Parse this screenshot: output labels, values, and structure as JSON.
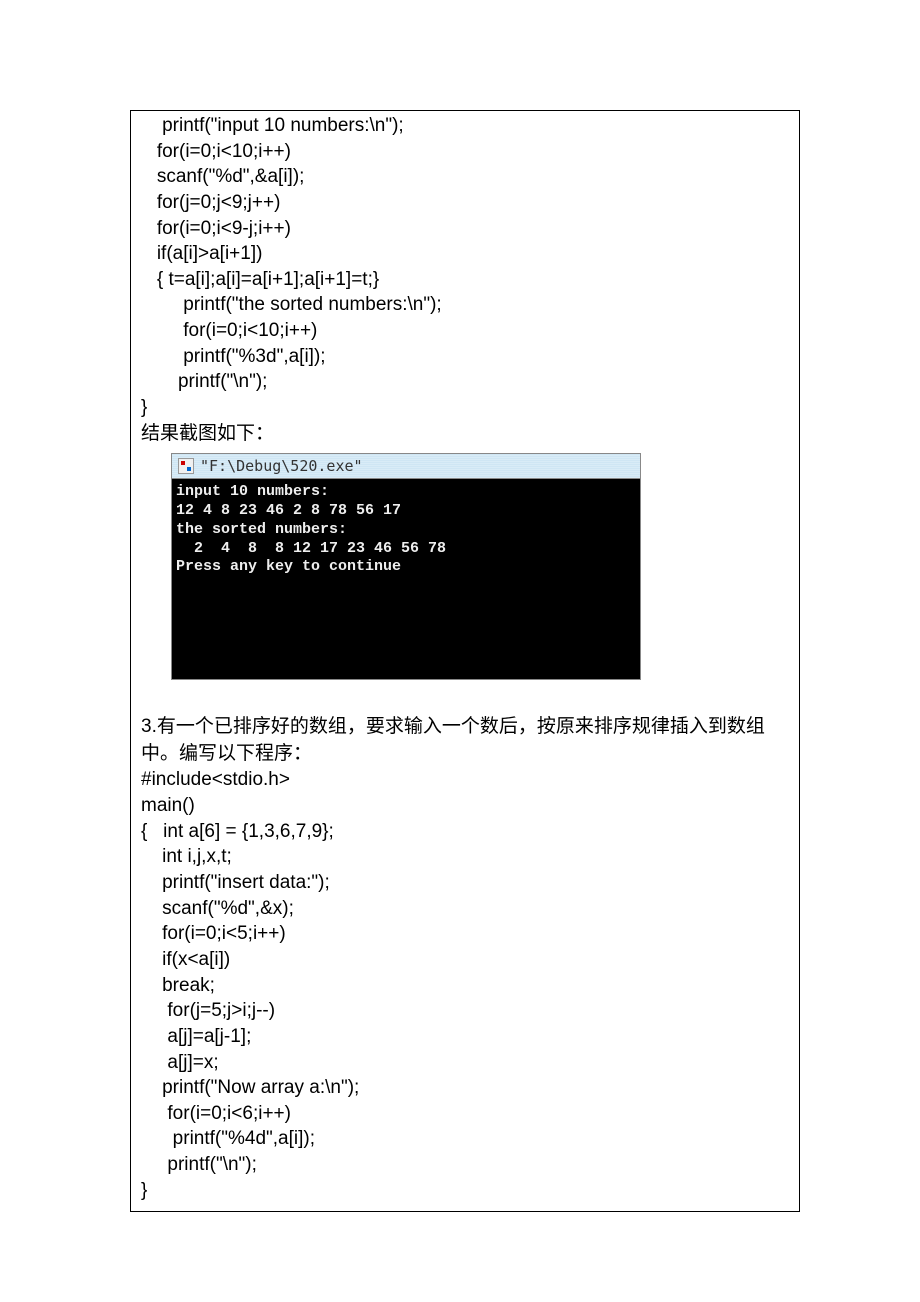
{
  "code_block_1": "    printf(\"input 10 numbers:\\n\");\n   for(i=0;i<10;i++)\n   scanf(\"%d\",&a[i]);\n   for(j=0;j<9;j++)\n   for(i=0;i<9-j;i++)\n   if(a[i]>a[i+1])\n   { t=a[i];a[i]=a[i+1];a[i+1]=t;}\n        printf(\"the sorted numbers:\\n\");\n        for(i=0;i<10;i++)\n        printf(\"%3d\",a[i]);\n       printf(\"\\n\");\n}",
  "result_caption": " 结果截图如下：",
  "console": {
    "title": "\"F:\\Debug\\520.exe\"",
    "lines": [
      "input 10 numbers:",
      "12 4 8 23 46 2 8 78 56 17",
      "the sorted numbers:",
      "  2  4  8  8 12 17 23 46 56 78",
      "Press any key to continue"
    ]
  },
  "problem3_text": "3.有一个已排序好的数组，要求输入一个数后，按原来排序规律插入到数组中。编写以下程序：",
  "code_block_2": "#include<stdio.h>\nmain()\n{   int a[6] = {1,3,6,7,9};\n    int i,j,x,t;\n    printf(\"insert data:\");\n    scanf(\"%d\",&x);\n    for(i=0;i<5;i++)\n    if(x<a[i])\n    break;\n     for(j=5;j>i;j--)\n     a[j]=a[j-1];\n     a[j]=x;\n    printf(\"Now array a:\\n\");\n     for(i=0;i<6;i++)\n      printf(\"%4d\",a[i]);\n     printf(\"\\n\");\n}"
}
